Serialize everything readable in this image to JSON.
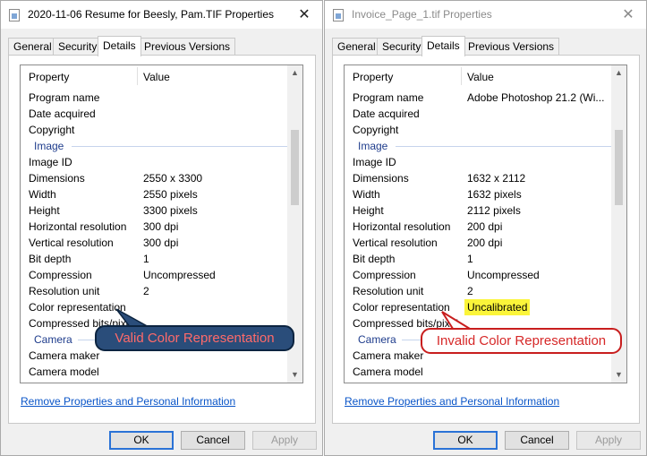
{
  "windows": [
    {
      "title": "2020-11-06 Resume for Beesly, Pam.TIF Properties",
      "close": "✕",
      "tabs": [
        "General",
        "Security",
        "Details",
        "Previous Versions"
      ],
      "active_tab": "Details",
      "header": {
        "property": "Property",
        "value": "Value"
      },
      "rows": [
        {
          "p": "Program name",
          "v": ""
        },
        {
          "p": "Date acquired",
          "v": ""
        },
        {
          "p": "Copyright",
          "v": ""
        },
        {
          "group": "Image"
        },
        {
          "p": "Image ID",
          "v": ""
        },
        {
          "p": "Dimensions",
          "v": "2550 x 3300"
        },
        {
          "p": "Width",
          "v": "2550 pixels"
        },
        {
          "p": "Height",
          "v": "3300 pixels"
        },
        {
          "p": "Horizontal resolution",
          "v": "300 dpi"
        },
        {
          "p": "Vertical resolution",
          "v": "300 dpi"
        },
        {
          "p": "Bit depth",
          "v": "1"
        },
        {
          "p": "Compression",
          "v": "Uncompressed"
        },
        {
          "p": "Resolution unit",
          "v": "2"
        },
        {
          "p": "Color representation",
          "v": ""
        },
        {
          "p": "Compressed bits/pixel",
          "v": ""
        },
        {
          "group": "Camera"
        },
        {
          "p": "Camera maker",
          "v": ""
        },
        {
          "p": "Camera model",
          "v": ""
        }
      ],
      "link": "Remove Properties and Personal Information",
      "buttons": {
        "ok": "OK",
        "cancel": "Cancel",
        "apply": "Apply"
      },
      "callout": "Valid Color Representation"
    },
    {
      "title": "Invoice_Page_1.tif Properties",
      "close": "✕",
      "tabs": [
        "General",
        "Security",
        "Details",
        "Previous Versions"
      ],
      "active_tab": "Details",
      "header": {
        "property": "Property",
        "value": "Value"
      },
      "rows": [
        {
          "p": "Program name",
          "v": "Adobe Photoshop 21.2 (Wi..."
        },
        {
          "p": "Date acquired",
          "v": ""
        },
        {
          "p": "Copyright",
          "v": ""
        },
        {
          "group": "Image"
        },
        {
          "p": "Image ID",
          "v": ""
        },
        {
          "p": "Dimensions",
          "v": "1632 x 2112"
        },
        {
          "p": "Width",
          "v": "1632 pixels"
        },
        {
          "p": "Height",
          "v": "2112 pixels"
        },
        {
          "p": "Horizontal resolution",
          "v": "200 dpi"
        },
        {
          "p": "Vertical resolution",
          "v": "200 dpi"
        },
        {
          "p": "Bit depth",
          "v": "1"
        },
        {
          "p": "Compression",
          "v": "Uncompressed"
        },
        {
          "p": "Resolution unit",
          "v": "2"
        },
        {
          "p": "Color representation",
          "v": "Uncalibrated",
          "highlight": true
        },
        {
          "p": "Compressed bits/pixel",
          "v": ""
        },
        {
          "group": "Camera"
        },
        {
          "p": "Camera maker",
          "v": ""
        },
        {
          "p": "Camera model",
          "v": ""
        }
      ],
      "link": "Remove Properties and Personal Information",
      "buttons": {
        "ok": "OK",
        "cancel": "Cancel",
        "apply": "Apply"
      },
      "callout": "Invalid Color Representation"
    }
  ],
  "colors": {
    "highlight": "#fbf53a",
    "valid_callout": "#2a4d7a",
    "invalid_callout_border": "#c81e1e",
    "callout_text": "#d62828",
    "link": "#0a55c8"
  }
}
